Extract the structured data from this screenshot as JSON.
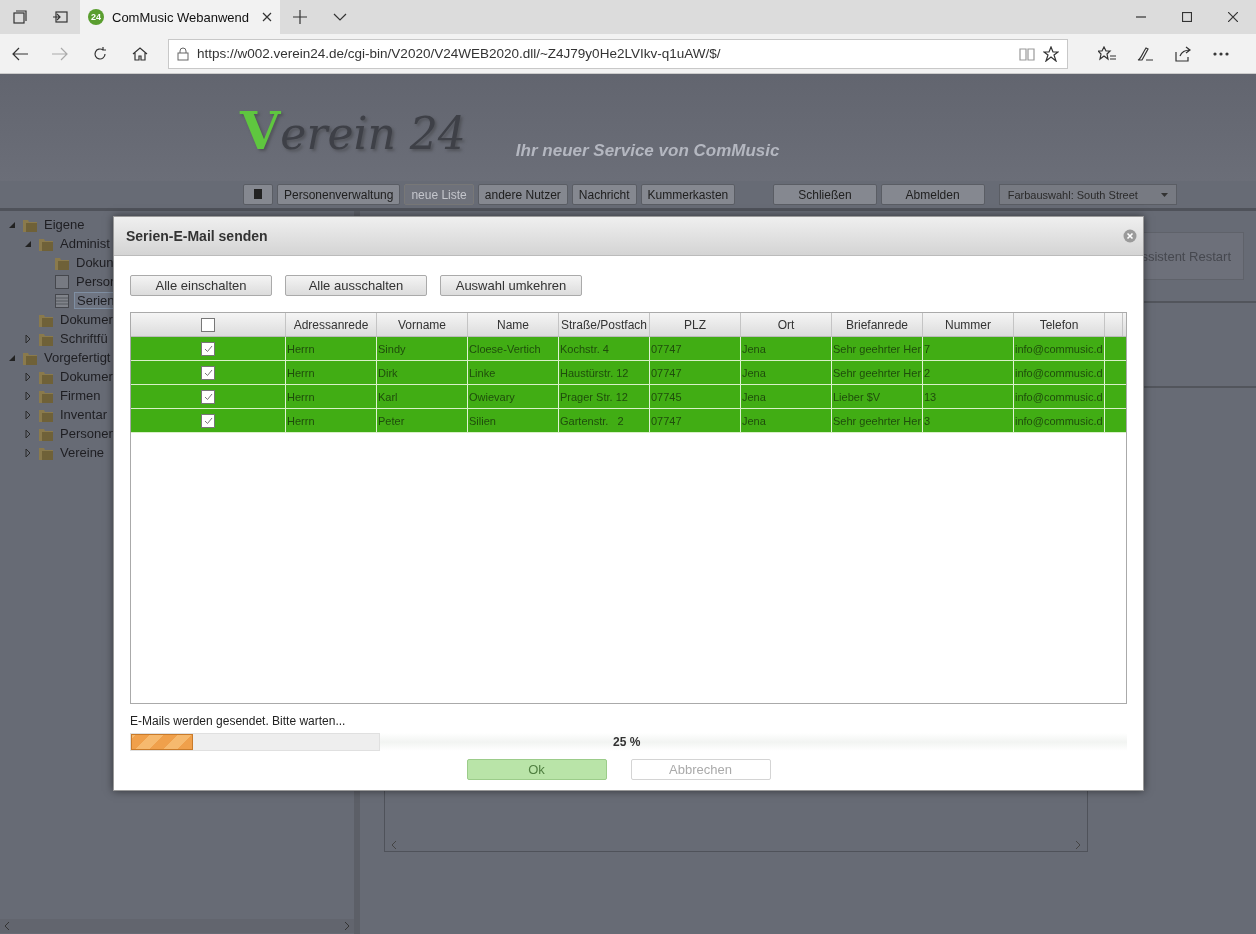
{
  "browser": {
    "tab_title": "ComMusic Webanwend",
    "favicon_text": "24",
    "url": "https://w002.verein24.de/cgi-bin/V2020/V24WEB2020.dll/~Z4J79y0He2LVIkv-q1uAW/$/",
    "forward_disabled": true
  },
  "header": {
    "logo_initial": "V",
    "logo_rest": "erein 24",
    "tagline": "Ihr neuer Service von ComMusic"
  },
  "toolbar": [
    {
      "label": "Personenverwaltung",
      "disabled": false,
      "wide": false
    },
    {
      "label": "neue Liste",
      "disabled": true,
      "wide": false
    },
    {
      "label": "andere Nutzer",
      "disabled": false,
      "wide": false
    },
    {
      "label": "Nachricht",
      "disabled": false,
      "wide": false
    },
    {
      "label": "Kummerkasten",
      "disabled": false,
      "wide": false
    },
    {
      "label": "Schließen",
      "disabled": false,
      "wide": true
    },
    {
      "label": "Abmelden",
      "disabled": false,
      "wide": true
    }
  ],
  "color_select": {
    "value": "Farbauswahl: South Street"
  },
  "tree": [
    {
      "label": "Eigene",
      "kind": "folder",
      "expanded": true,
      "selected": false,
      "children": [
        {
          "label": "Administ",
          "kind": "folder",
          "expanded": true,
          "selected": false,
          "children": [
            {
              "label": "Dokun",
              "kind": "folder",
              "selected": false
            },
            {
              "label": "Persor",
              "kind": "page",
              "selected": false
            },
            {
              "label": "Serien",
              "kind": "table",
              "selected": true
            }
          ]
        },
        {
          "label": "Dokumer",
          "kind": "folder",
          "selected": false
        },
        {
          "label": "Schriftfü",
          "kind": "folder",
          "expanded": false,
          "selected": false
        }
      ]
    },
    {
      "label": "Vorgefertigt",
      "kind": "folder",
      "expanded": true,
      "selected": false,
      "children": [
        {
          "label": "Dokumer",
          "kind": "folder",
          "expanded": false,
          "selected": false
        },
        {
          "label": "Firmen",
          "kind": "folder",
          "expanded": false,
          "selected": false
        },
        {
          "label": "Inventar",
          "kind": "folder",
          "expanded": false,
          "selected": false
        },
        {
          "label": "Personen",
          "kind": "folder",
          "expanded": false,
          "selected": false
        },
        {
          "label": "Vereine",
          "kind": "folder",
          "expanded": false,
          "selected": false
        }
      ]
    }
  ],
  "background_button": {
    "label": "ssistent Restart"
  },
  "dialog": {
    "title": "Serien-E-Mail senden",
    "actions": [
      "Alle einschalten",
      "Alle ausschalten",
      "Auswahl umkehren"
    ],
    "table": {
      "all_checked": false,
      "columns": [
        "Adressanrede",
        "Vorname",
        "Name",
        "Straße/Postfach",
        "PLZ",
        "Ort",
        "Briefanrede",
        "Nummer",
        "Telefon"
      ],
      "rows": [
        {
          "checked": true,
          "selected": true,
          "cells": [
            "Herrn",
            "Sindy",
            "Cloese-Vertich",
            "Kochstr. 4",
            "07747",
            "Jena",
            "Sehr geehrter Her",
            "7",
            "info@commusic.d"
          ]
        },
        {
          "checked": true,
          "selected": true,
          "cells": [
            "Herrn",
            "Dirk",
            "Linke",
            "Haustürstr. 12",
            "07747",
            "Jena",
            "Sehr geehrter Her",
            "2",
            "info@commusic.d"
          ]
        },
        {
          "checked": true,
          "selected": true,
          "cells": [
            "Herrn",
            "Karl",
            "Owievary",
            "Prager Str. 12",
            "07745",
            "Jena",
            "Lieber $V",
            "13",
            "info@commusic.d"
          ]
        },
        {
          "checked": true,
          "selected": true,
          "cells": [
            "Herrn",
            "Peter",
            "Silien",
            "Gartenstr.   2",
            "07747",
            "Jena",
            "Sehr geehrter Her",
            "3",
            "info@commusic.d"
          ]
        }
      ]
    },
    "status": "E-Mails werden gesendet. Bitte warten...",
    "progress": {
      "level": 0.25,
      "label": "25 %"
    },
    "buttons": [
      {
        "label": "Ok",
        "kind": "primary",
        "disabled": true
      },
      {
        "label": "Abbrechen",
        "kind": "secondary",
        "disabled": true
      }
    ]
  }
}
